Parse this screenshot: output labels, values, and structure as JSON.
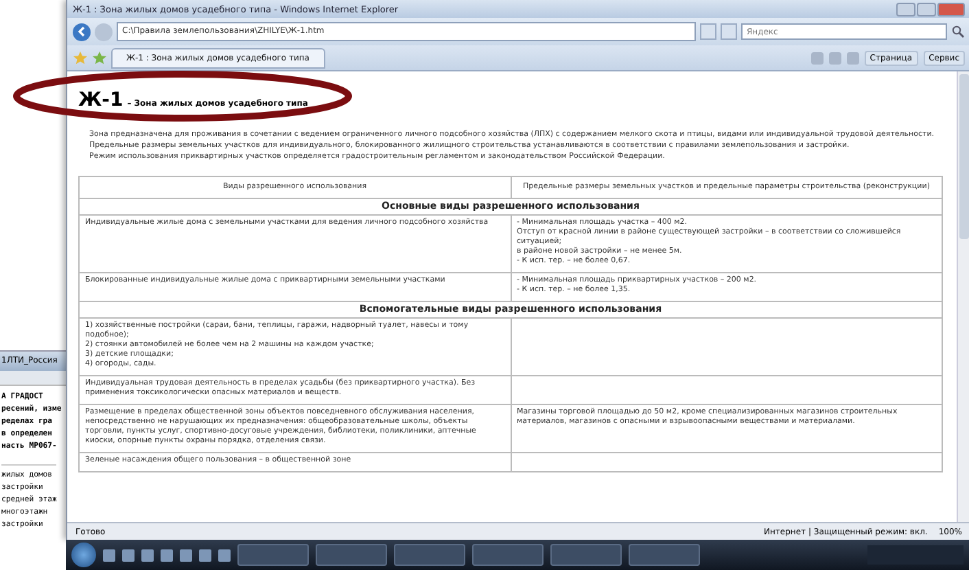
{
  "background_window": {
    "title": "1ЛТИ_Россия",
    "lines": [
      "А ГРАДОСТ",
      "ресений, изме",
      "ределах гра",
      "в определен",
      "насть МР067-"
    ],
    "list_lines": [
      "жилых домов",
      "застройки",
      "средней этаж",
      "многоэтажн",
      "застройки"
    ]
  },
  "window": {
    "title": "Ж-1 : Зона жилых домов усадебного типа - Windows Internet Explorer"
  },
  "address_bar": {
    "url": "C:\\Правила землепользования\\ZHILYE\\Ж-1.htm"
  },
  "search": {
    "placeholder": "Яндекс"
  },
  "tabs": [
    {
      "label": "Ж-1 : Зона жилых домов усадебного типа",
      "selected": true
    }
  ],
  "commands": [
    "Страница",
    "Сервис"
  ],
  "page": {
    "code": "Ж-1",
    "title": "– Зона жилых домов усадебного типа",
    "paragraphs": [
      "Зона предназначена для проживания в сочетании с ведением ограниченного личного подсобного хозяйства (ЛПХ) с содержанием мелкого скота и птицы, видами или индивидуальной трудовой деятельности.",
      "Предельные размеры земельных участков для индивидуального, блокированного жилищного строительства устанавливаются в соответствии с правилами землепользования и застройки.",
      "Режим использования приквартирных участков определяется градостроительным регламентом и законодательством Российской Федерации."
    ]
  },
  "table": {
    "columns": [
      "Виды разрешенного использования",
      "Предельные размеры земельных участков и предельные параметры строительства (реконструкции)"
    ],
    "sections": [
      {
        "title": "Основные виды разрешенного использования",
        "rows": [
          {
            "use": [
              "Индивидуальные жилые дома с земельными участками для ведения личного подсобного хозяйства"
            ],
            "limits": [
              "- Минимальная площадь участка – 400 м2.",
              "Отступ от красной линии в районе существующей застройки – в соответствии со сложившейся ситуацией;",
              "в районе новой застройки – не менее 5м.",
              "- К исп. тер. – не более 0,67."
            ]
          },
          {
            "use": [
              "Блокированные индивидуальные жилые дома с приквартирными земельными участками"
            ],
            "limits": [
              "- Минимальная площадь приквартирных участков – 200 м2.",
              "- К исп. тер. – не более 1,35."
            ]
          }
        ]
      },
      {
        "title": "Вспомогательные виды разрешенного использования",
        "rows": [
          {
            "use": [
              "1) хозяйственные постройки (сараи, бани, теплицы, гаражи, надворный туалет, навесы и тому подобное);",
              "2) стоянки автомобилей не более чем на 2 машины на каждом участке;",
              "3) детские площадки;",
              "4) огороды, сады."
            ],
            "limits": []
          },
          {
            "use": [
              "Индивидуальная трудовая деятельность в пределах усадьбы (без приквартирного участка). Без применения токсикологически опасных материалов и веществ."
            ],
            "limits": []
          },
          {
            "use": [
              "Размещение в пределах общественной зоны объектов повседневного обслуживания населения, непосредственно не нарушающих их предназначения: общеобразовательные школы, объекты торговли, пункты услуг, спортивно-досуговые учреждения, библиотеки, поликлиники, аптечные киоски, опорные пункты охраны порядка, отделения связи."
            ],
            "limits": [
              "Магазины торговой площадью до 50 м2, кроме специализированных магазинов строительных материалов, магазинов с опасными и взрывоопасными веществами и материалами."
            ]
          },
          {
            "use": [
              "Зеленые насаждения общего пользования – в общественной зоне"
            ],
            "limits": []
          }
        ]
      }
    ]
  },
  "status_bar": {
    "text": "Готово",
    "zone": "Интернет | Защищенный режим: вкл.",
    "zoom": "100%"
  }
}
